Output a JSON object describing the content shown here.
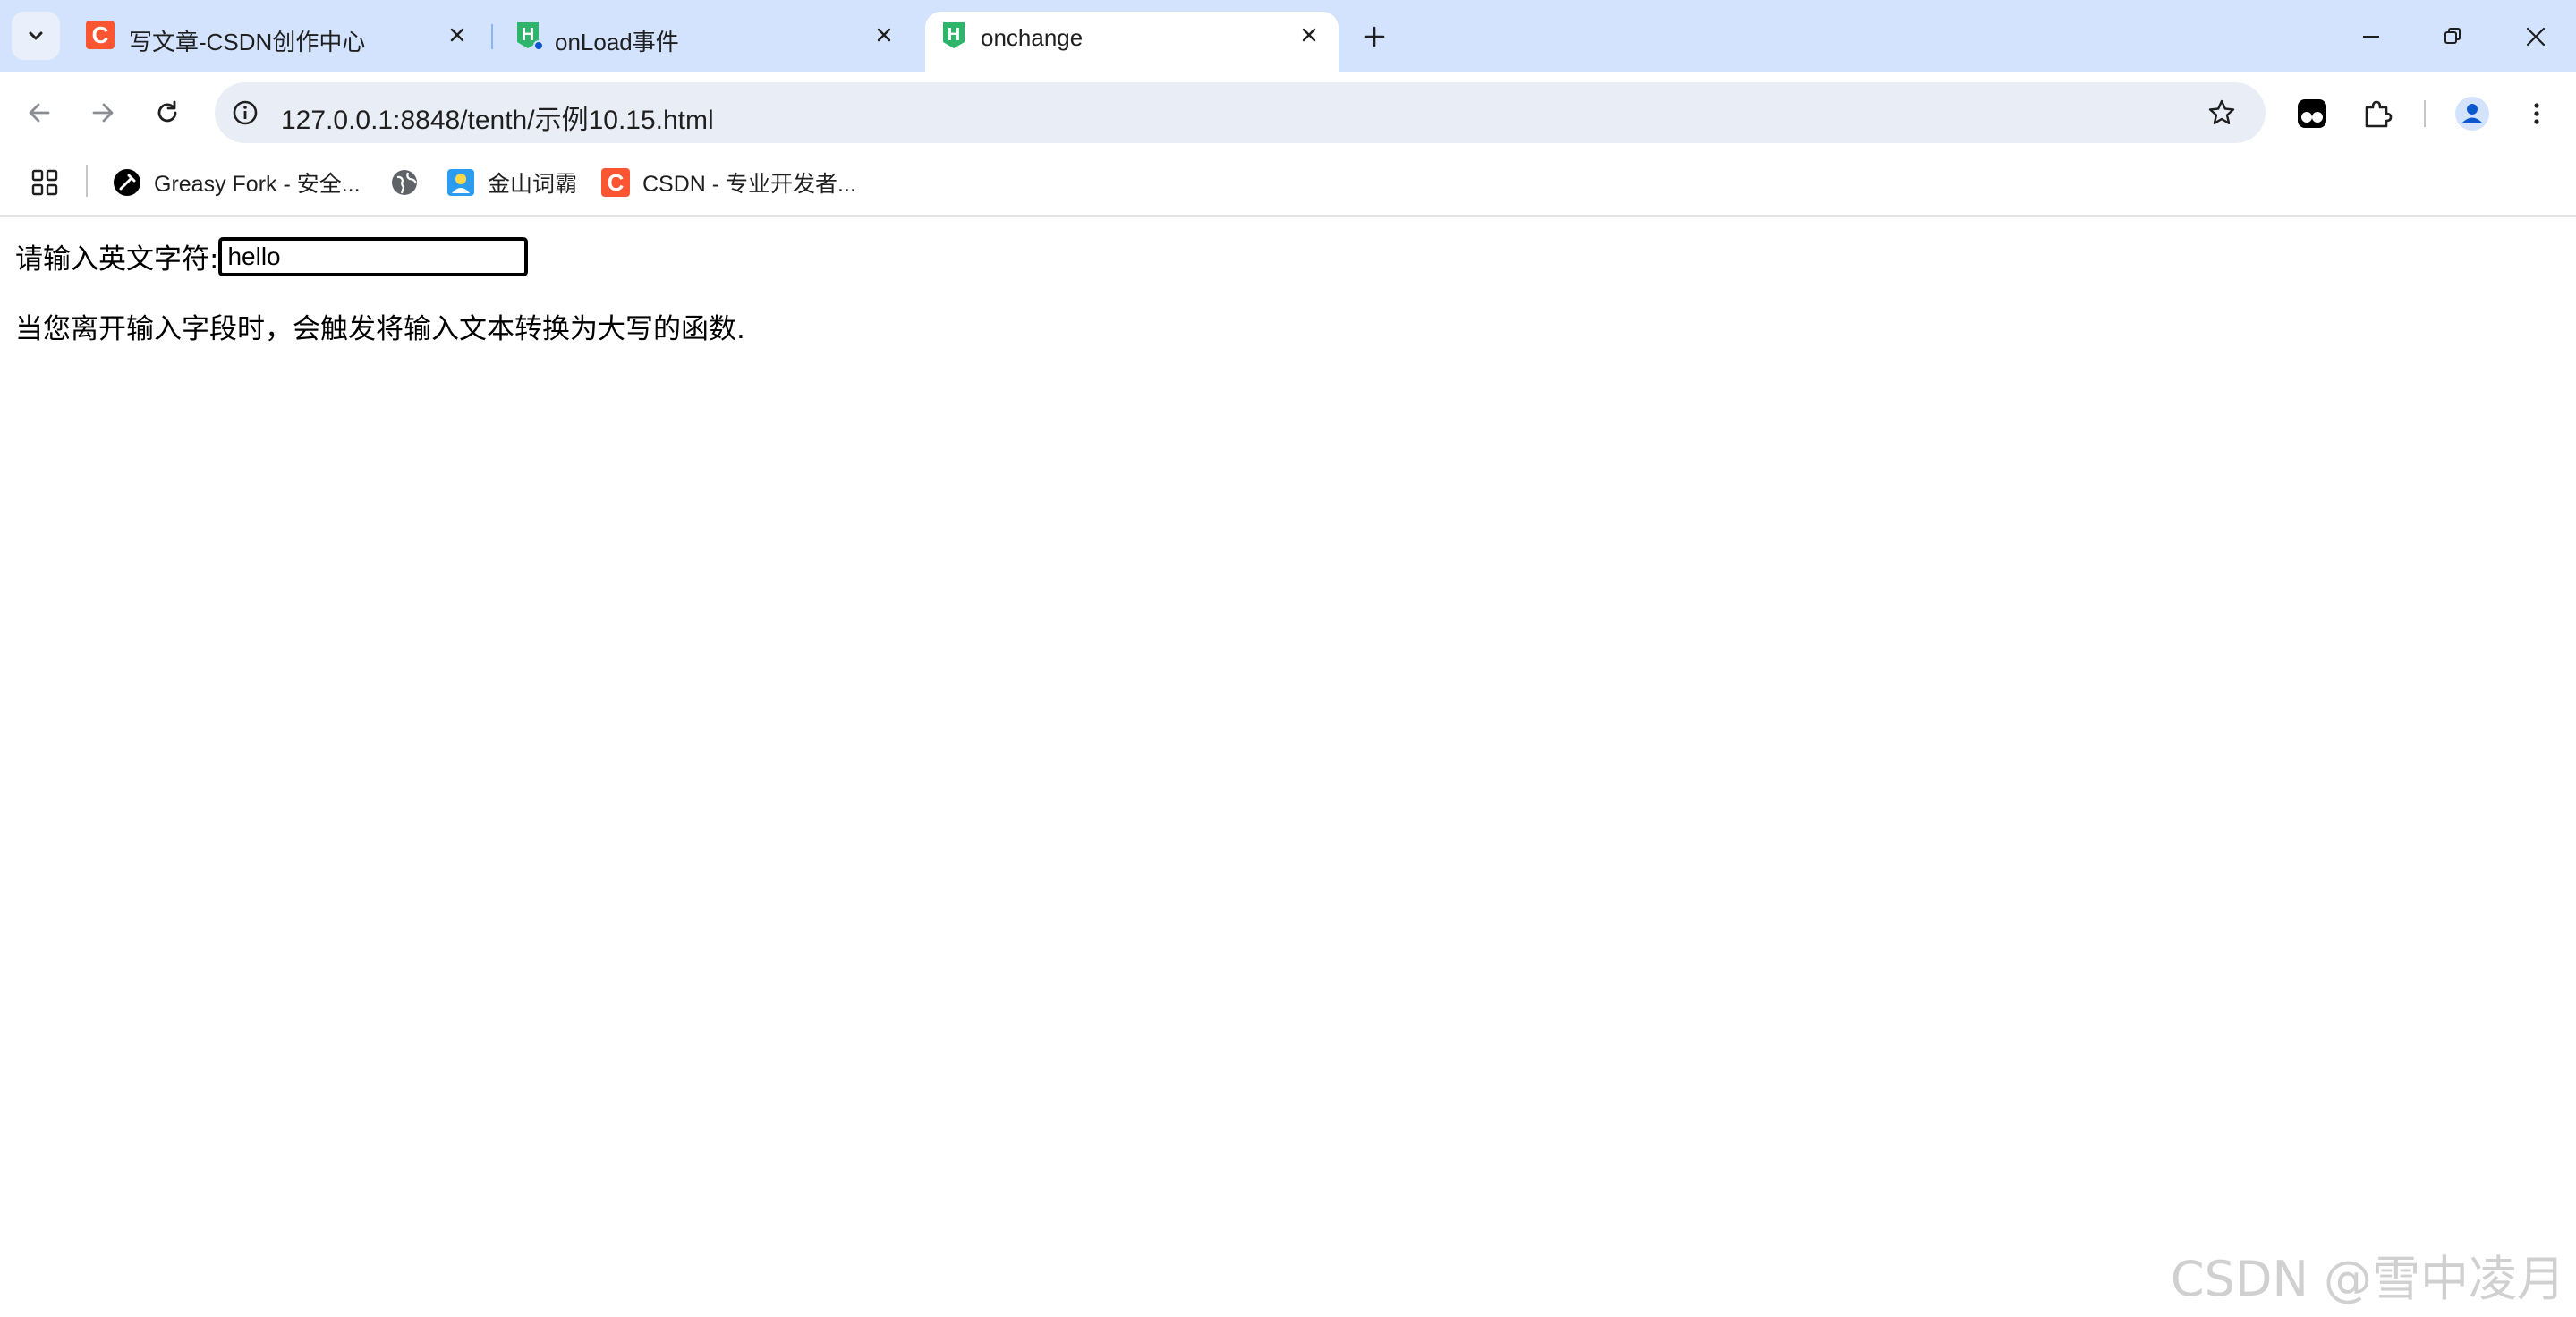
{
  "tabs": [
    {
      "title": "写文章-CSDN创作中心",
      "favicon": "csdn-icon",
      "active": false
    },
    {
      "title": "onLoad事件",
      "favicon": "hbuilder-icon",
      "active": false
    },
    {
      "title": "onchange",
      "favicon": "hbuilder-icon",
      "active": true
    }
  ],
  "toolbar": {
    "url": "127.0.0.1:8848/tenth/示例10.15.html"
  },
  "bookmarks": [
    {
      "label": "Greasy Fork - 安全...",
      "icon": "greasyfork-icon"
    },
    {
      "label": "",
      "icon": "globe-icon"
    },
    {
      "label": "金山词霸",
      "icon": "iciba-icon"
    },
    {
      "label": "CSDN - 专业开发者...",
      "icon": "csdn-icon"
    }
  ],
  "page": {
    "label": "请输入英文字符:",
    "input_value": "hello",
    "description": "当您离开输入字段时，会触发将输入文本转换为大写的函数."
  },
  "watermark": "CSDN @雪中凌月",
  "colors": {
    "tabstrip": "#d3e3fd",
    "omnibox": "#e9eef6",
    "csdn": "#fc5531",
    "hbuilder": "#2fb46c",
    "profile": "#0b57d0"
  }
}
